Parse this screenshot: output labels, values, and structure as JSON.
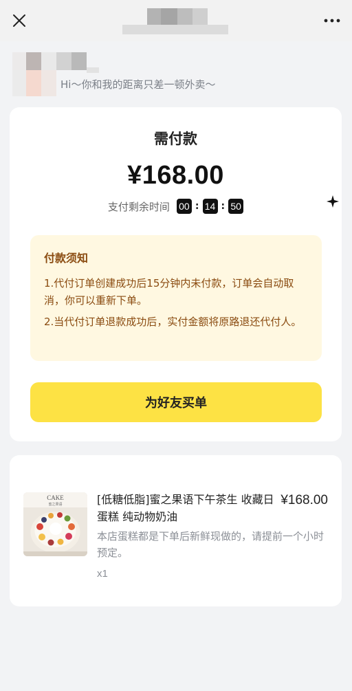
{
  "header": {
    "close_icon": "close-icon",
    "more_icon": "more-dots-icon"
  },
  "greeting": {
    "text": "Hi～你和我的距离只差一顿外卖～"
  },
  "payment": {
    "title": "需付款",
    "amount": "¥168.00",
    "timer_label": "支付剩余时间",
    "timer": {
      "h": "00",
      "m": "14",
      "s": "50"
    },
    "notice_title": "付款须知",
    "notice_items": [
      "1.代付订单创建成功后15分钟内未付款，订单会自动取消，你可以重新下单。",
      "2.当代付订单退款成功后，实付金额将原路退还代付人。"
    ],
    "buy_button": "为好友买单"
  },
  "order": {
    "product_name": "[低糖低脂]蜜之果语下午茶生 收藏日蛋糕 纯动物奶油",
    "price": "¥168.00",
    "description": "本店蛋糕都是下单后新鲜现做的，请提前一个小时预定。",
    "quantity": "x1",
    "image_text": {
      "brand": "CAKE",
      "sub": "蜜之果语"
    }
  },
  "colors": {
    "accent": "#fde244",
    "notice_bg": "#fff8e1",
    "notice_text": "#8a4b10",
    "background": "#f2f3f5"
  }
}
